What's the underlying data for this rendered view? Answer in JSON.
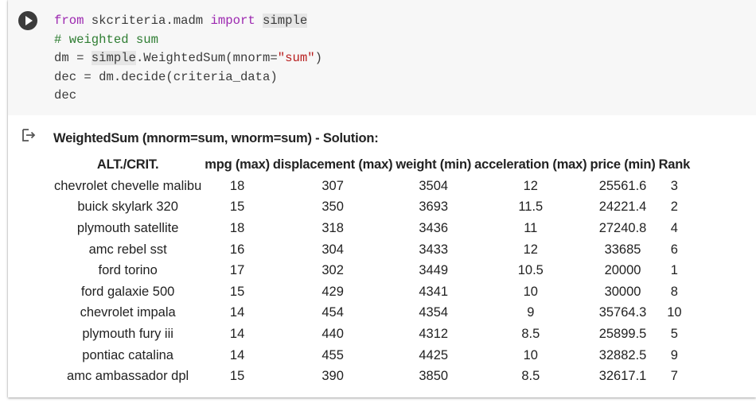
{
  "code_cell": {
    "lines": [
      [
        {
          "t": "from",
          "c": "kw"
        },
        {
          "t": " skcriteria.madm ",
          "c": ""
        },
        {
          "t": "import",
          "c": "kw"
        },
        {
          "t": " ",
          "c": ""
        },
        {
          "t": "simple",
          "c": "hl"
        }
      ],
      [
        {
          "t": "# weighted sum",
          "c": "cm"
        }
      ],
      [
        {
          "t": "dm = ",
          "c": ""
        },
        {
          "t": "simple",
          "c": "hl"
        },
        {
          "t": ".WeightedSum(mnorm=",
          "c": ""
        },
        {
          "t": "\"sum\"",
          "c": "st"
        },
        {
          "t": ")",
          "c": ""
        }
      ],
      [
        {
          "t": "dec = dm.decide(criteria_data)",
          "c": ""
        }
      ],
      [
        {
          "t": "dec",
          "c": ""
        }
      ]
    ]
  },
  "output": {
    "title": "WeightedSum (mnorm=sum, wnorm=sum) - Solution:",
    "table": {
      "headers": [
        "ALT./CRIT.",
        "mpg (max)",
        "displacement (max)",
        "weight (min)",
        "acceleration (max)",
        "price (min)",
        "Rank"
      ],
      "rows": [
        [
          "chevrolet chevelle malibu",
          "18",
          "307",
          "3504",
          "12",
          "25561.6",
          "3"
        ],
        [
          "buick skylark 320",
          "15",
          "350",
          "3693",
          "11.5",
          "24221.4",
          "2"
        ],
        [
          "plymouth satellite",
          "18",
          "318",
          "3436",
          "11",
          "27240.8",
          "4"
        ],
        [
          "amc rebel sst",
          "16",
          "304",
          "3433",
          "12",
          "33685",
          "6"
        ],
        [
          "ford torino",
          "17",
          "302",
          "3449",
          "10.5",
          "20000",
          "1"
        ],
        [
          "ford galaxie 500",
          "15",
          "429",
          "4341",
          "10",
          "30000",
          "8"
        ],
        [
          "chevrolet impala",
          "14",
          "454",
          "4354",
          "9",
          "35764.3",
          "10"
        ],
        [
          "plymouth fury iii",
          "14",
          "440",
          "4312",
          "8.5",
          "25899.5",
          "5"
        ],
        [
          "pontiac catalina",
          "14",
          "455",
          "4425",
          "10",
          "32882.5",
          "9"
        ],
        [
          "amc ambassador dpl",
          "15",
          "390",
          "3850",
          "8.5",
          "32617.1",
          "7"
        ]
      ]
    }
  },
  "icons": {
    "run": "play-icon",
    "output": "output-arrow-icon"
  },
  "colors": {
    "code_bg": "#f7f7f7",
    "keyword": "#9c27b0",
    "comment": "#2e7d32",
    "string": "#b71c1c",
    "run_button": "#3c3c3c"
  }
}
